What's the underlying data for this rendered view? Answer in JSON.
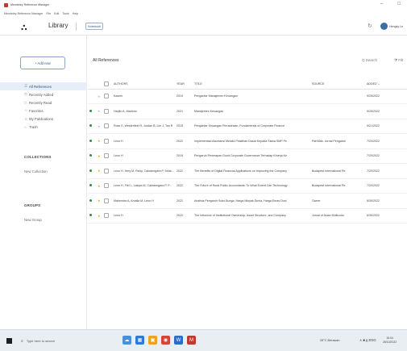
{
  "window": {
    "title": "Mendeley Reference Manager",
    "controls": [
      "–",
      "□"
    ]
  },
  "menu": [
    "Mendeley Reference Manager",
    "File",
    "Edit",
    "Tools",
    "Help"
  ],
  "header": {
    "logo": "∴",
    "title": "Library",
    "notebook_label": "Notebook",
    "user_name": "Hengky Le"
  },
  "sidebar": {
    "add_new": "+ Add new",
    "items": [
      {
        "icon": "☰",
        "label": "All References"
      },
      {
        "icon": "◷",
        "label": "Recently Added"
      },
      {
        "icon": "□",
        "label": "Recently Read"
      },
      {
        "icon": "☆",
        "label": "Favorites"
      },
      {
        "icon": "☺",
        "label": "My Publications"
      },
      {
        "icon": "⌂",
        "label": "Trash"
      }
    ],
    "collections_title": "COLLECTIONS",
    "new_collection": "New Collection",
    "groups_title": "GROUPS",
    "new_group": "New Group"
  },
  "main": {
    "title": "All References",
    "search_label": "Q  Search",
    "filter_label": "⧩  Filt",
    "columns": [
      "AUTHORS",
      "YEAR",
      "TITLE",
      "SOURCE",
      "ADDED ⌄"
    ],
    "rows": [
      {
        "unread": false,
        "fav": false,
        "authors": "Kasmir",
        "year": "2019",
        "title": "Pengantar Manajemen Keuangan",
        "source": "",
        "added": "9/25/2022"
      },
      {
        "unread": true,
        "fav": false,
        "authors": "Harjito A, Martono",
        "year": "2021",
        "title": "Manajemen Keuangan",
        "source": "",
        "added": "9/25/2022"
      },
      {
        "unread": true,
        "fav": false,
        "authors": "Ross S, Westerfield R, Jordan B, Lim J, Tan R",
        "year": "2015",
        "title": "Pengantar Keuangan Perusahaan, Fundamental of Corporate Finance",
        "source": "",
        "added": "9/21/2022"
      },
      {
        "unread": true,
        "fav": true,
        "authors": "Leon H",
        "year": "2022",
        "title": "Implementasi Akuntansi Melalui Pelatihan Dasar Kepada Siswa SMP Pe",
        "source": "PaKMas: Jurnal Pengabdi",
        "added": "7/20/2022"
      },
      {
        "unread": true,
        "fav": true,
        "authors": "Leon H",
        "year": "2019",
        "title": "Pengaruh Penerapan Good Corporate Governance Terhadap Kinerja Ke",
        "source": "",
        "added": "7/20/2022"
      },
      {
        "unread": true,
        "fav": true,
        "authors": "Leon H, Hery M, Ricky, Cakranegara P, Setia...",
        "year": "2022",
        "title": "The Benefits of Digital Financial Applications on Improving the Company",
        "source": "Budapest International Re",
        "added": "7/20/2022"
      },
      {
        "unread": true,
        "fav": true,
        "authors": "Leon H, Fitri L, Latupa M, Cakranegara P, P...",
        "year": "2022",
        "title": "The Future of Rural Public Accountants: To What Extent Can Technology",
        "source": "Budapest International Re",
        "added": "7/20/2022"
      },
      {
        "unread": true,
        "fav": true,
        "authors": "Mahendra A, Amalia M, Leon H",
        "year": "2022",
        "title": "Analisis Pengaruh Suku Bunga, Harga Minyak Dunia, Harga Emas Duni",
        "source": "Owner",
        "added": "6/30/2022"
      },
      {
        "unread": true,
        "fav": true,
        "authors": "Leon H",
        "year": "2022",
        "title": "The Influence of Institutional Ownership, Asset Structure, and Company",
        "source": "Jurnal of Asian Multicultu",
        "added": "6/30/2022"
      }
    ]
  },
  "taskbar": {
    "search_placeholder": "Type here to search",
    "weather": "28°C  Berawan",
    "tray": "∧  ■  д  ENG",
    "time": "15:04",
    "date": "26/10/2022"
  },
  "colors": {
    "accent": "#3a5a80",
    "unread_dot": "#2f8a4a",
    "favorite_star": "#e0b000",
    "active_nav": "#e6eef8"
  }
}
